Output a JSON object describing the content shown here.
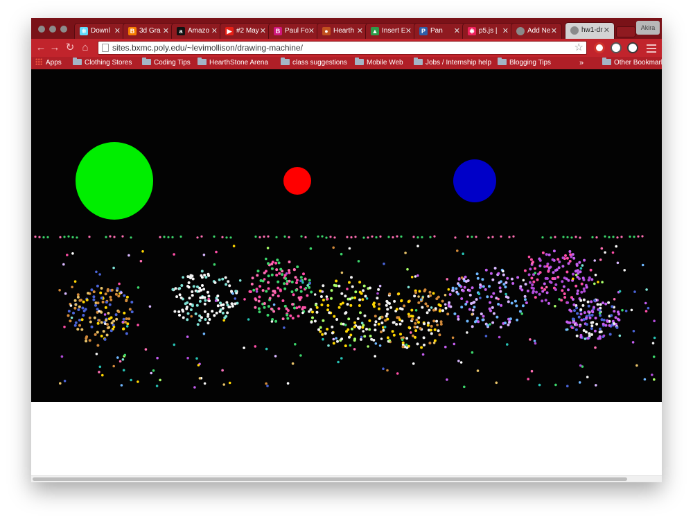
{
  "browser": {
    "url": "sites.bxmc.poly.edu/~levimollison/drawing-machine/",
    "profile_label": "Akira",
    "colors": {
      "tabstrip": "#7a1218",
      "toolbar": "#c1242c",
      "bookmarks_bar": "#b01f27"
    },
    "tabs": [
      {
        "title": "Downl",
        "icon": "react-icon",
        "icon_color": "#61dafb",
        "active": false
      },
      {
        "title": "3d Gra",
        "icon": "blogger-icon",
        "icon_color": "#f57d00",
        "active": false
      },
      {
        "title": "Amazo",
        "icon": "amazon-icon",
        "icon_color": "#111111",
        "active": false
      },
      {
        "title": "#2 May",
        "icon": "youtube-icon",
        "icon_color": "#e62117",
        "active": false
      },
      {
        "title": "Paul Fo",
        "icon": "b-icon",
        "icon_color": "#d0177e",
        "active": false
      },
      {
        "title": "Hearth",
        "icon": "hearthstone-icon",
        "icon_color": "#c0511f",
        "active": false
      },
      {
        "title": "Insert E",
        "icon": "a-logo-icon",
        "icon_color": "#2d9c4a",
        "active": false
      },
      {
        "title": "Pan",
        "icon": "p-icon",
        "icon_color": "#2f5fa8",
        "active": false
      },
      {
        "title": "p5.js |",
        "icon": "p5-asterisk-icon",
        "icon_color": "#ed225d",
        "active": false
      },
      {
        "title": "Add Ne",
        "icon": "apple-icon",
        "icon_color": "#8a8a8a",
        "active": false
      },
      {
        "title": "hw1-dr",
        "icon": "apple-icon",
        "icon_color": "#8a8a8a",
        "active": true
      }
    ]
  },
  "bookmarks": [
    {
      "label": "Apps",
      "icon": "apps-grid-icon"
    },
    {
      "label": "Clothing Stores",
      "icon": "folder-icon"
    },
    {
      "label": "Coding Tips",
      "icon": "folder-icon"
    },
    {
      "label": "HearthStone Arena",
      "icon": "folder-icon"
    },
    {
      "label": "class suggestions",
      "icon": "folder-icon"
    },
    {
      "label": "Mobile Web",
      "icon": "folder-icon"
    },
    {
      "label": "Jobs / Internship help",
      "icon": "folder-icon"
    },
    {
      "label": "Blogging Tips",
      "icon": "folder-icon"
    },
    {
      "label": "Other Bookmarks",
      "icon": "folder-icon"
    }
  ],
  "bookmarks_overflow": "»",
  "sketch": {
    "background": "#030303",
    "circles": [
      {
        "color": "#00ee00"
      },
      {
        "color": "#ff0000"
      },
      {
        "color": "#0000c8"
      }
    ],
    "dot_palette": [
      "#e8c36a",
      "#d9b8ff",
      "#7fe3d6",
      "#ff6fb3",
      "#ffd600",
      "#f2f2f2",
      "#3cd66b",
      "#c45ef0",
      "#6fb7ff",
      "#4a64d8",
      "#d48b3a",
      "#ff4fa8",
      "#a8ff6a",
      "#ffffff",
      "#27c2b4",
      "#b04ad8"
    ]
  }
}
